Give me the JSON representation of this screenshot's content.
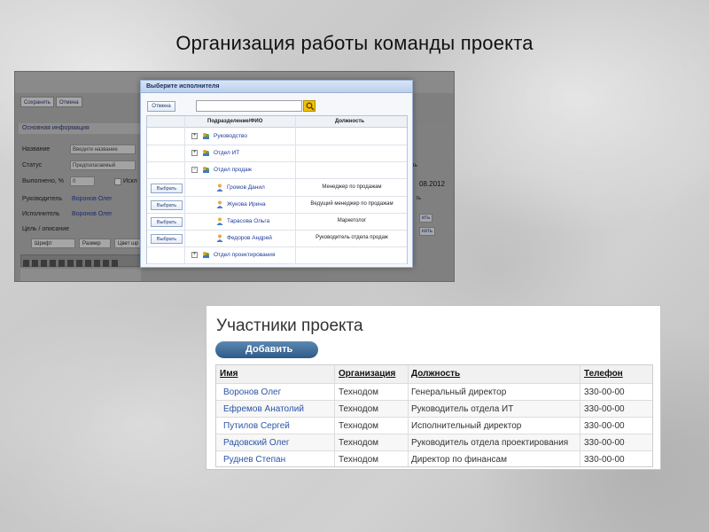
{
  "slide": {
    "title": "Организация работы команды проекта"
  },
  "form_screen": {
    "toolbar": {
      "save_label": "Сохранить",
      "cancel_label": "Отмена"
    },
    "section_title": "Основная информация",
    "fields": {
      "name_label": "Название",
      "name_placeholder": "Введите название",
      "status_label": "Статус",
      "status_value": "Предполагаемый",
      "progress_label": "Выполнено, %",
      "progress_value": "0",
      "exclude_label": "Искл",
      "manager_label": "Руководитель",
      "manager_value": "Воронов Олег",
      "executor_label": "Исполнитель",
      "executor_value": "Воронов Олег",
      "goal_label": "Цель / описание"
    },
    "editor": {
      "font_label": "Шрифт",
      "size_label": "Размер",
      "color_label": "Цвет шр"
    },
    "right_side": {
      "date_value": "08.2012",
      "field_tail": "ть",
      "btn_a": "ить",
      "btn_b": "кить"
    }
  },
  "dialog": {
    "title": "Выберите исполнителя",
    "cancel_label": "Отмена",
    "columns": {
      "unit": "Подразделение/ФИО",
      "position": "Должность"
    },
    "select_label": "Выбрать",
    "rows": [
      {
        "kind": "dept",
        "expander": "+",
        "name": "Руководство",
        "position": ""
      },
      {
        "kind": "dept",
        "expander": "+",
        "name": "Отдел ИТ",
        "position": ""
      },
      {
        "kind": "dept",
        "expander": "−",
        "name": "Отдел продаж",
        "position": ""
      },
      {
        "kind": "person",
        "name": "Громов Данил",
        "position": "Менеджер по продажам"
      },
      {
        "kind": "person",
        "name": "Жукова Ирина",
        "position": "Ведущий менеджер по продажам"
      },
      {
        "kind": "person",
        "name": "Тарасова Ольга",
        "position": "Маркетолог"
      },
      {
        "kind": "person",
        "name": "Федоров Андрей",
        "position": "Руководитель отдела продаж"
      },
      {
        "kind": "dept",
        "expander": "+",
        "name": "Отдел проектирования",
        "position": ""
      }
    ]
  },
  "participants": {
    "title": "Участники проекта",
    "add_label": "Добавить",
    "columns": {
      "name": "Имя",
      "org": "Организация",
      "position": "Должность",
      "phone": "Телефон"
    },
    "rows": [
      {
        "name": "Воронов Олег",
        "org": "Технодом",
        "position": "Генеральный директор",
        "phone": "330-00-00"
      },
      {
        "name": "Ефремов Анатолий",
        "org": "Технодом",
        "position": "Руководитель отдела ИТ",
        "phone": "330-00-00"
      },
      {
        "name": "Путилов Сергей",
        "org": "Технодом",
        "position": "Исполнительный директор",
        "phone": "330-00-00"
      },
      {
        "name": "Радовский Олег",
        "org": "Технодом",
        "position": "Руководитель отдела проектирования",
        "phone": "330-00-00"
      },
      {
        "name": "Руднев Степан",
        "org": "Технодом",
        "position": "Директор по финансам",
        "phone": "330-00-00"
      }
    ]
  },
  "colors": {
    "link": "#2c54a8",
    "add_button": "#2c5a88",
    "dialog_header": "#bcd0ec",
    "search_button": "#f2c200"
  }
}
